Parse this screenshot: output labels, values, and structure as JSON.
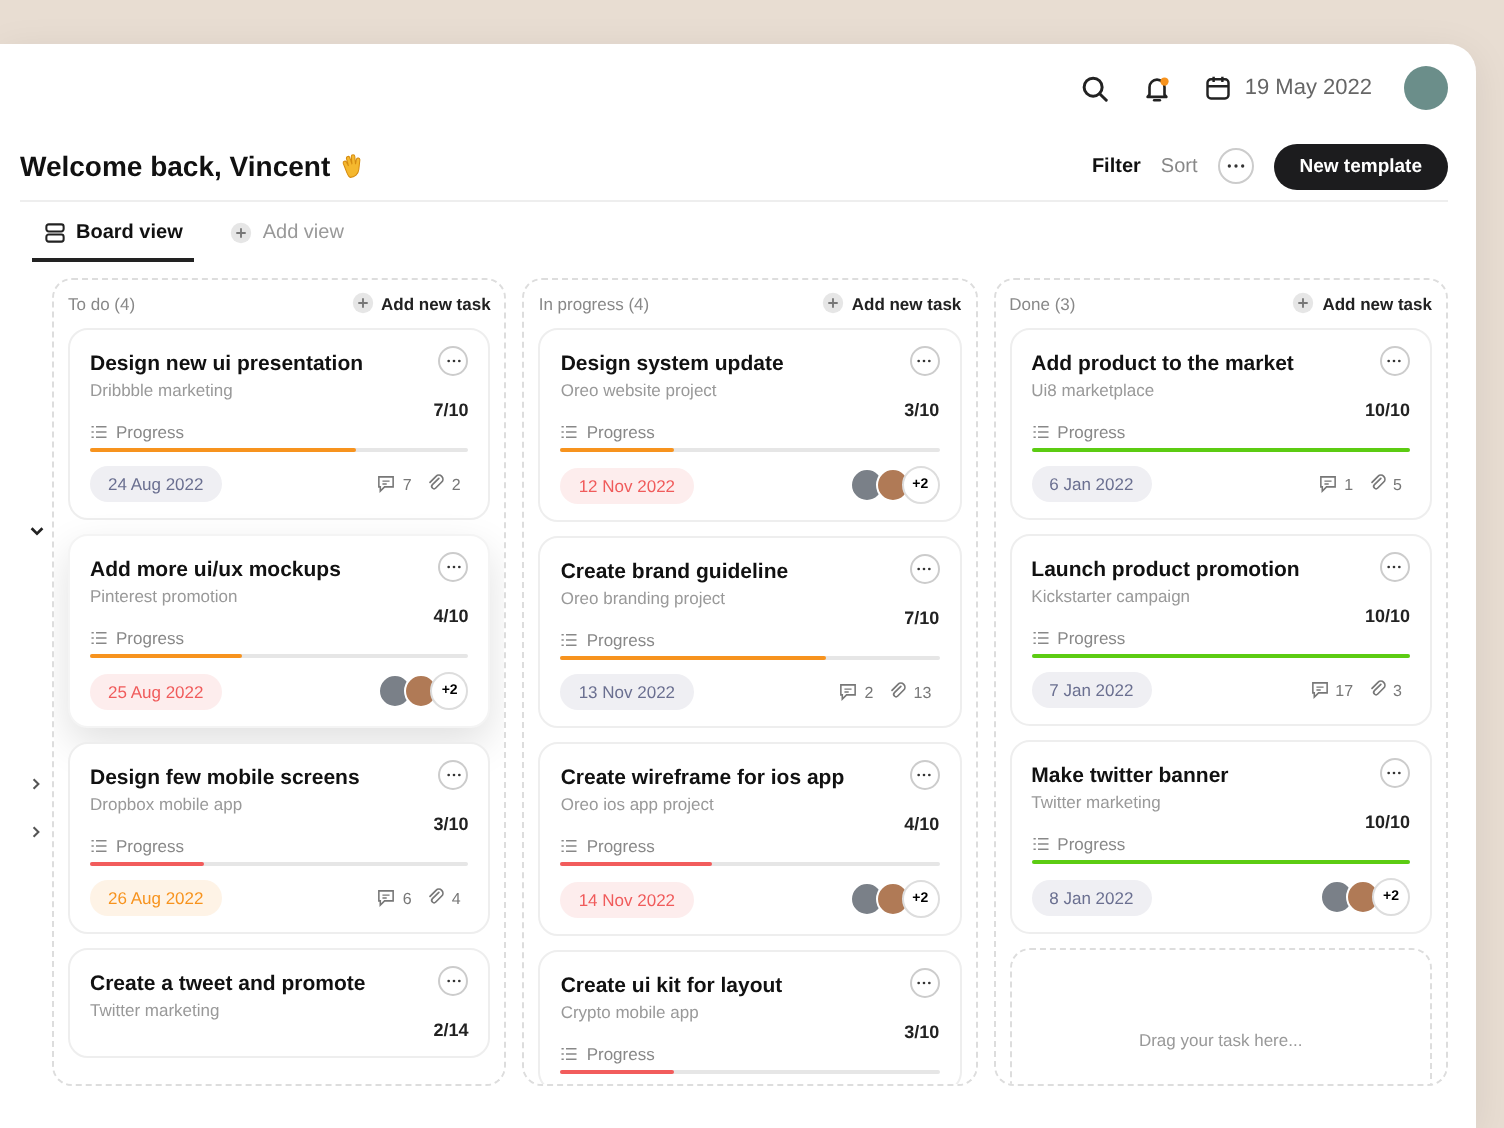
{
  "header": {
    "date": "19 May 2022",
    "has_notification": true
  },
  "welcome": {
    "title": "Welcome back, Vincent"
  },
  "toolbar": {
    "filters": [
      {
        "label": "Filter",
        "selected": true
      },
      {
        "label": "Sort",
        "selected": false
      }
    ],
    "primary_button": "New template"
  },
  "tabs": [
    {
      "label": "Board view",
      "kind": "board",
      "selected": true
    },
    {
      "label": "Add view",
      "kind": "add",
      "selected": false
    }
  ],
  "columns": [
    {
      "title": "To do (4)",
      "add_label": "Add new task",
      "cards": [
        {
          "title": "Design new ui presentation",
          "subtitle": "Dribbble marketing",
          "ratio": "7/10",
          "progress_label": "Progress",
          "level": 0.7,
          "color": "#f7931e",
          "date": {
            "text": "24 Aug 2022",
            "color": "#6a6f90"
          },
          "dragging": false,
          "footer": {
            "kind": "stats",
            "comments": "7",
            "attachments": "2"
          }
        },
        {
          "title": "Add more ui/ux mockups",
          "subtitle": "Pinterest promotion",
          "ratio": "4/10",
          "progress_label": "Progress",
          "level": 0.4,
          "color": "#f7931e",
          "date": {
            "text": "25 Aug 2022",
            "color": "#f05b5b"
          },
          "dragging": true,
          "footer": {
            "kind": "avatars",
            "extra": "+2"
          }
        },
        {
          "title": "Design few mobile screens",
          "subtitle": "Dropbox mobile app",
          "ratio": "3/10",
          "progress_label": "Progress",
          "level": 0.3,
          "color": "#f25c5c",
          "date": {
            "text": "26 Aug 2022",
            "color": "#f7931e"
          },
          "dragging": false,
          "footer": {
            "kind": "stats",
            "comments": "6",
            "attachments": "4"
          }
        },
        {
          "title": "Create a tweet and promote",
          "subtitle": "Twitter marketing",
          "ratio": "2/14",
          "dragging": false
        }
      ]
    },
    {
      "title": "In progress (4)",
      "add_label": "Add new task",
      "cards": [
        {
          "title": "Design system update",
          "subtitle": "Oreo website project",
          "ratio": "3/10",
          "progress_label": "Progress",
          "level": 0.3,
          "color": "#f7931e",
          "date": {
            "text": "12 Nov 2022",
            "color": "#f05b5b"
          },
          "dragging": false,
          "footer": {
            "kind": "avatars",
            "extra": "+2"
          }
        },
        {
          "title": "Create brand guideline",
          "subtitle": "Oreo branding project",
          "ratio": "7/10",
          "progress_label": "Progress",
          "level": 0.7,
          "color": "#f7931e",
          "date": {
            "text": "13 Nov 2022",
            "color": "#6a6f90"
          },
          "dragging": false,
          "footer": {
            "kind": "stats",
            "comments": "2",
            "attachments": "13"
          }
        },
        {
          "title": "Create wireframe for ios app",
          "subtitle": "Oreo ios app project",
          "ratio": "4/10",
          "progress_label": "Progress",
          "level": 0.4,
          "color": "#f25c5c",
          "date": {
            "text": "14 Nov 2022",
            "color": "#f05b5b"
          },
          "dragging": false,
          "footer": {
            "kind": "avatars",
            "extra": "+2"
          }
        },
        {
          "title": "Create ui kit for layout",
          "subtitle": "Crypto mobile app",
          "ratio": "3/10",
          "progress_label": "Progress",
          "level": 0.3,
          "color": "#f25c5c",
          "dragging": false
        }
      ]
    },
    {
      "title": "Done (3)",
      "add_label": "Add new task",
      "drop_hint": "Drag your task here...",
      "cards": [
        {
          "title": "Add product to the market",
          "subtitle": "Ui8 marketplace",
          "ratio": "10/10",
          "progress_label": "Progress",
          "level": 1,
          "color": "#5ccc12",
          "date": {
            "text": "6 Jan 2022",
            "color": "#6a6f90"
          },
          "dragging": false,
          "footer": {
            "kind": "stats",
            "comments": "1",
            "attachments": "5"
          }
        },
        {
          "title": "Launch product promotion",
          "subtitle": "Kickstarter campaign",
          "ratio": "10/10",
          "progress_label": "Progress",
          "level": 1,
          "color": "#5ccc12",
          "date": {
            "text": "7 Jan 2022",
            "color": "#6a6f90"
          },
          "dragging": false,
          "footer": {
            "kind": "stats",
            "comments": "17",
            "attachments": "3"
          }
        },
        {
          "title": "Make twitter banner",
          "subtitle": "Twitter marketing",
          "ratio": "10/10",
          "progress_label": "Progress",
          "level": 1,
          "color": "#5ccc12",
          "date": {
            "text": "8 Jan 2022",
            "color": "#6a6f90"
          },
          "dragging": false,
          "footer": {
            "kind": "avatars",
            "extra": "+2"
          }
        }
      ]
    }
  ]
}
